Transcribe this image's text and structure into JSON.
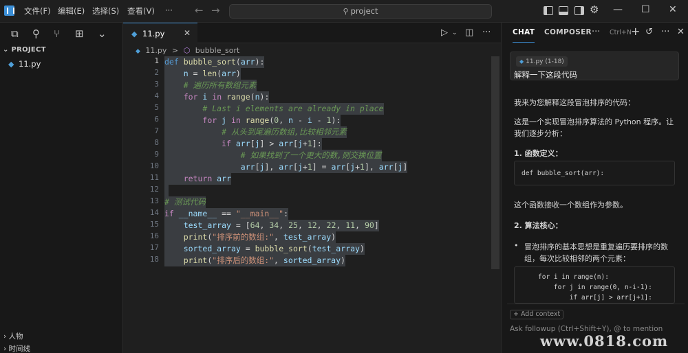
{
  "titlebar": {
    "menus": [
      "文件(F)",
      "编辑(E)",
      "选择(S)",
      "查看(V)",
      "···"
    ],
    "search": "project",
    "search_icon": "search-icon"
  },
  "sidebar": {
    "section": "PROJECT",
    "file": "11.py",
    "bottom_sections": [
      "人物",
      "时间线"
    ]
  },
  "editor": {
    "tab": "11.py",
    "breadcrumb": [
      "11.py",
      ">",
      "bubble_sort"
    ],
    "line_numbers": [
      "1",
      "2",
      "3",
      "4",
      "5",
      "6",
      "7",
      "8",
      "9",
      "10",
      "11",
      "12",
      "13",
      "14",
      "15",
      "16",
      "17",
      "18"
    ],
    "lines": [
      [
        {
          "t": "def ",
          "c": "kw2"
        },
        {
          "t": "bubble_sort",
          "c": "fn"
        },
        {
          "t": "(",
          "c": ""
        },
        {
          "t": "arr",
          "c": "var"
        },
        {
          "t": "):",
          "c": ""
        }
      ],
      [
        {
          "t": "    ",
          "c": ""
        },
        {
          "t": "n",
          "c": "var"
        },
        {
          "t": " = ",
          "c": ""
        },
        {
          "t": "len",
          "c": "fn"
        },
        {
          "t": "(",
          "c": ""
        },
        {
          "t": "arr",
          "c": "var"
        },
        {
          "t": ")",
          "c": ""
        }
      ],
      [
        {
          "t": "    ",
          "c": ""
        },
        {
          "t": "# 遍历所有数组元素",
          "c": "cm"
        }
      ],
      [
        {
          "t": "    ",
          "c": ""
        },
        {
          "t": "for ",
          "c": "kw"
        },
        {
          "t": "i",
          "c": "var"
        },
        {
          "t": " in ",
          "c": "kw"
        },
        {
          "t": "range",
          "c": "fn"
        },
        {
          "t": "(",
          "c": ""
        },
        {
          "t": "n",
          "c": "var"
        },
        {
          "t": "):",
          "c": ""
        }
      ],
      [
        {
          "t": "        ",
          "c": ""
        },
        {
          "t": "# Last i elements are already in place",
          "c": "cm"
        }
      ],
      [
        {
          "t": "        ",
          "c": ""
        },
        {
          "t": "for ",
          "c": "kw"
        },
        {
          "t": "j",
          "c": "var"
        },
        {
          "t": " in ",
          "c": "kw"
        },
        {
          "t": "range",
          "c": "fn"
        },
        {
          "t": "(",
          "c": ""
        },
        {
          "t": "0",
          "c": "num"
        },
        {
          "t": ", ",
          "c": ""
        },
        {
          "t": "n",
          "c": "var"
        },
        {
          "t": " - ",
          "c": ""
        },
        {
          "t": "i",
          "c": "var"
        },
        {
          "t": " - ",
          "c": ""
        },
        {
          "t": "1",
          "c": "num"
        },
        {
          "t": "):",
          "c": ""
        }
      ],
      [
        {
          "t": "            ",
          "c": ""
        },
        {
          "t": "# 从头到尾遍历数组,比较相邻元素",
          "c": "cm"
        }
      ],
      [
        {
          "t": "            ",
          "c": ""
        },
        {
          "t": "if ",
          "c": "kw"
        },
        {
          "t": "arr",
          "c": "var"
        },
        {
          "t": "[",
          "c": ""
        },
        {
          "t": "j",
          "c": "var"
        },
        {
          "t": "] > ",
          "c": ""
        },
        {
          "t": "arr",
          "c": "var"
        },
        {
          "t": "[",
          "c": ""
        },
        {
          "t": "j",
          "c": "var"
        },
        {
          "t": "+",
          "c": ""
        },
        {
          "t": "1",
          "c": "num"
        },
        {
          "t": "]:",
          "c": ""
        }
      ],
      [
        {
          "t": "                ",
          "c": ""
        },
        {
          "t": "# 如果找到了一个更大的数,则交换位置",
          "c": "cm"
        }
      ],
      [
        {
          "t": "                ",
          "c": ""
        },
        {
          "t": "arr",
          "c": "var"
        },
        {
          "t": "[",
          "c": ""
        },
        {
          "t": "j",
          "c": "var"
        },
        {
          "t": "], ",
          "c": ""
        },
        {
          "t": "arr",
          "c": "var"
        },
        {
          "t": "[",
          "c": ""
        },
        {
          "t": "j",
          "c": "var"
        },
        {
          "t": "+",
          "c": ""
        },
        {
          "t": "1",
          "c": "num"
        },
        {
          "t": "] = ",
          "c": ""
        },
        {
          "t": "arr",
          "c": "var"
        },
        {
          "t": "[",
          "c": ""
        },
        {
          "t": "j",
          "c": "var"
        },
        {
          "t": "+",
          "c": ""
        },
        {
          "t": "1",
          "c": "num"
        },
        {
          "t": "], ",
          "c": ""
        },
        {
          "t": "arr",
          "c": "var"
        },
        {
          "t": "[",
          "c": ""
        },
        {
          "t": "j",
          "c": "var"
        },
        {
          "t": "]",
          "c": ""
        }
      ],
      [
        {
          "t": "    ",
          "c": ""
        },
        {
          "t": "return ",
          "c": "kw"
        },
        {
          "t": "arr",
          "c": "var"
        }
      ],
      [],
      [
        {
          "t": "# 测试代码",
          "c": "cm"
        }
      ],
      [
        {
          "t": "if ",
          "c": "kw"
        },
        {
          "t": "__name__",
          "c": "var"
        },
        {
          "t": " == ",
          "c": ""
        },
        {
          "t": "\"__main__\"",
          "c": "str"
        },
        {
          "t": ":",
          "c": ""
        }
      ],
      [
        {
          "t": "    ",
          "c": ""
        },
        {
          "t": "test_array",
          "c": "var"
        },
        {
          "t": " = [",
          "c": ""
        },
        {
          "t": "64",
          "c": "num"
        },
        {
          "t": ", ",
          "c": ""
        },
        {
          "t": "34",
          "c": "num"
        },
        {
          "t": ", ",
          "c": ""
        },
        {
          "t": "25",
          "c": "num"
        },
        {
          "t": ", ",
          "c": ""
        },
        {
          "t": "12",
          "c": "num"
        },
        {
          "t": ", ",
          "c": ""
        },
        {
          "t": "22",
          "c": "num"
        },
        {
          "t": ", ",
          "c": ""
        },
        {
          "t": "11",
          "c": "num"
        },
        {
          "t": ", ",
          "c": ""
        },
        {
          "t": "90",
          "c": "num"
        },
        {
          "t": "]",
          "c": ""
        }
      ],
      [
        {
          "t": "    ",
          "c": ""
        },
        {
          "t": "print",
          "c": "fn"
        },
        {
          "t": "(",
          "c": ""
        },
        {
          "t": "\"排序前的数组:\"",
          "c": "str"
        },
        {
          "t": ", ",
          "c": ""
        },
        {
          "t": "test_array",
          "c": "var"
        },
        {
          "t": ")",
          "c": ""
        }
      ],
      [
        {
          "t": "    ",
          "c": ""
        },
        {
          "t": "sorted_array",
          "c": "var"
        },
        {
          "t": " = ",
          "c": ""
        },
        {
          "t": "bubble_sort",
          "c": "fn"
        },
        {
          "t": "(",
          "c": ""
        },
        {
          "t": "test_array",
          "c": "var"
        },
        {
          "t": ")",
          "c": ""
        }
      ],
      [
        {
          "t": "    ",
          "c": ""
        },
        {
          "t": "print",
          "c": "fn"
        },
        {
          "t": "(",
          "c": ""
        },
        {
          "t": "\"排序后的数组:\"",
          "c": "str"
        },
        {
          "t": ", ",
          "c": ""
        },
        {
          "t": "sorted_array",
          "c": "var"
        },
        {
          "t": ")",
          "c": ""
        }
      ]
    ]
  },
  "panel": {
    "tabs": [
      "CHAT",
      "COMPOSER"
    ],
    "shortcut": "Ctrl+N",
    "context_chip": "11.py (1-18)",
    "user_message": "解释一下这段代码",
    "intro": "我来为您解释这段冒泡排序的代码：",
    "desc": "这是一个实现冒泡排序算法的 Python 程序。让我们逐步分析：",
    "h1": "1. 函数定义：",
    "code1": "def bubble_sort(arr):",
    "p1": "这个函数接收一个数组作为参数。",
    "h2": "2. 算法核心：",
    "bullet": "冒泡排序的基本思想是重复遍历要排序的数组，每次比较相邻的两个元素：",
    "code2": [
      "for i in range(n):",
      "    for j in range(0, n-i-1):",
      "        if arr[j] > arr[j+1]:"
    ],
    "add_context": "+ Add context",
    "followup": "Ask followup (Ctrl+Shift+Y), @ to mention"
  },
  "watermark": "www.0818.com"
}
